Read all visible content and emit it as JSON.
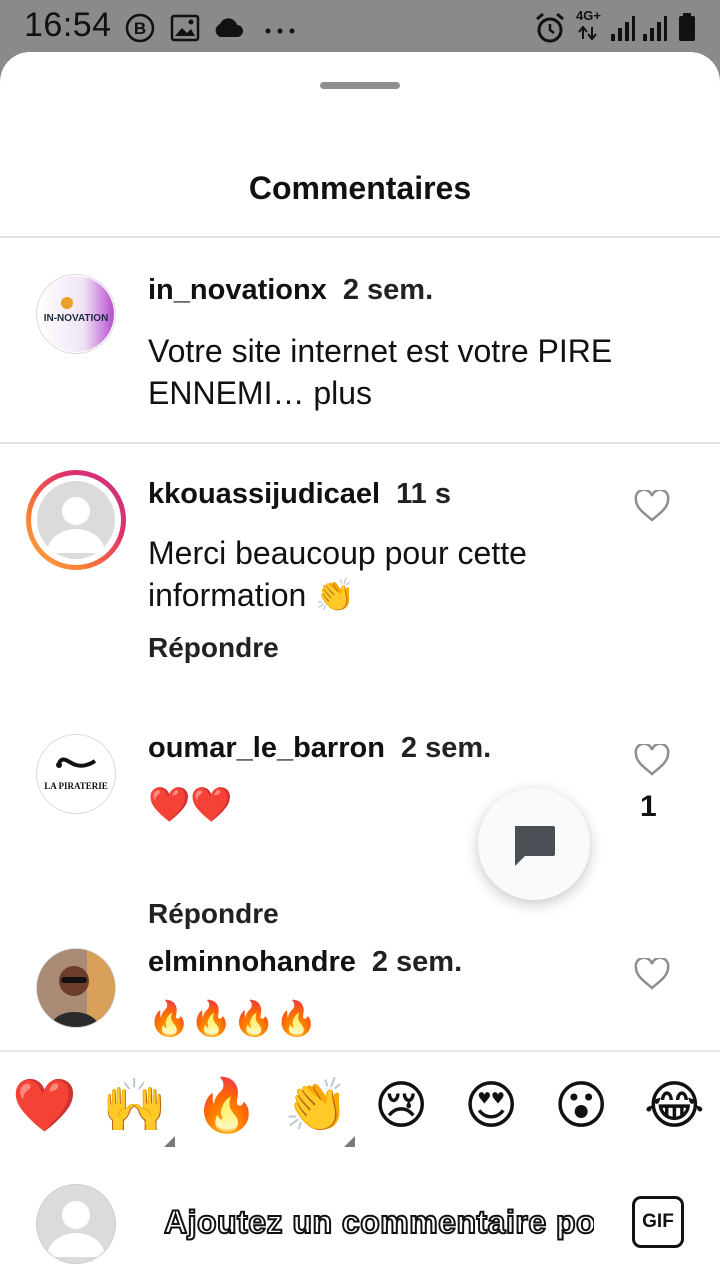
{
  "status_bar": {
    "time": "16:54",
    "network": "4G+",
    "icons": [
      "b-badge-icon",
      "image-icon",
      "cloud-icon",
      "more-dots-icon",
      "alarm-icon",
      "signal-icon",
      "signal-icon",
      "battery-icon"
    ]
  },
  "sheet": {
    "title": "Commentaires"
  },
  "caption": {
    "username": "in_novationx",
    "time": "2 sem.",
    "text": "Votre site internet est votre PIRE ENNEMI… plus",
    "avatar_text": "IN-NOVATION"
  },
  "comments": [
    {
      "username": "kkouassijudicael",
      "time": "11 s",
      "text": "Merci beaucoup pour cette information 👏",
      "reply_label": "Répondre",
      "likes": ""
    },
    {
      "username": "oumar_le_barron",
      "time": "2 sem.",
      "text": "❤️❤️",
      "reply_label": "Répondre",
      "likes": "1",
      "avatar_text": "LA PIRATERIE"
    },
    {
      "username": "elminnohandre",
      "time": "2 sem.",
      "text": "🔥🔥🔥🔥",
      "reply_label": "",
      "likes": ""
    }
  ],
  "quick_emojis": [
    "❤️",
    "🙌",
    "🔥",
    "👏",
    "😢",
    "😍",
    "😮",
    "😂"
  ],
  "input": {
    "placeholder": "Ajoutez un commentaire po",
    "gif_label": "GIF"
  },
  "colors": {
    "status_bar_bg": "#8a8a8a",
    "story_ring_start": "#fcaf45",
    "story_ring_end": "#c13584"
  }
}
